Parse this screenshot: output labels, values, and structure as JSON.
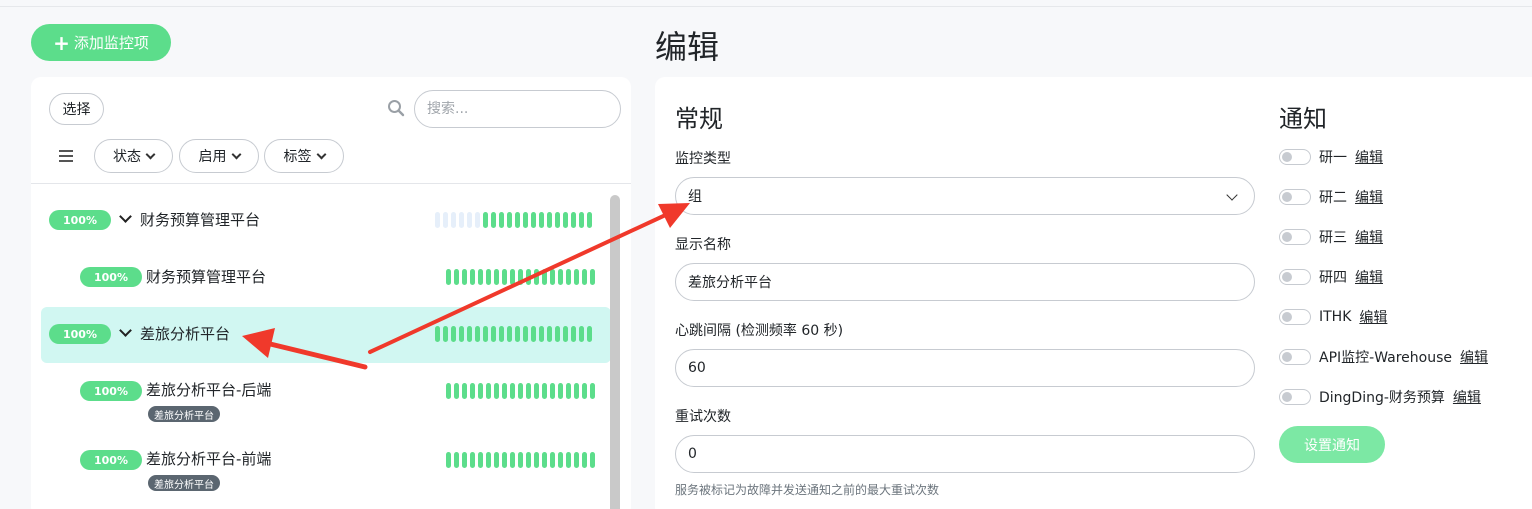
{
  "header": {
    "add_button": "添加监控项",
    "page_title": "编辑"
  },
  "left": {
    "select_label": "选择",
    "search_placeholder": "搜索...",
    "filters": [
      "状态",
      "启用",
      "标签"
    ],
    "monitors": [
      {
        "uptime": "100%",
        "name": "财务预算管理平台",
        "expandable": true,
        "indent": 0,
        "active": false,
        "tag": ""
      },
      {
        "uptime": "100%",
        "name": "财务预算管理平台",
        "expandable": false,
        "indent": 1,
        "active": false,
        "tag": ""
      },
      {
        "uptime": "100%",
        "name": "差旅分析平台",
        "expandable": true,
        "indent": 0,
        "active": true,
        "tag": ""
      },
      {
        "uptime": "100%",
        "name": "差旅分析平台-后端",
        "expandable": false,
        "indent": 1,
        "active": false,
        "tag": "差旅分析平台"
      },
      {
        "uptime": "100%",
        "name": "差旅分析平台-前端",
        "expandable": false,
        "indent": 1,
        "active": false,
        "tag": "差旅分析平台"
      }
    ]
  },
  "general": {
    "title": "常规",
    "monitor_type_label": "监控类型",
    "monitor_type_value": "组",
    "display_name_label": "显示名称",
    "display_name_value": "差旅分析平台",
    "interval_label": "心跳间隔 (检测频率 60 秒)",
    "interval_value": "60",
    "retries_label": "重试次数",
    "retries_value": "0",
    "retries_hint": "服务被标记为故障并发送通知之前的最大重试次数"
  },
  "notifications": {
    "title": "通知",
    "edit_label": "编辑",
    "items": [
      "研一",
      "研二",
      "研三",
      "研四",
      "ITHK",
      "API监控-Warehouse",
      "DingDing-财务预算"
    ],
    "setup_button": "设置通知"
  },
  "colors": {
    "accent": "#5cdd8b",
    "active_row": "#d1f7f2",
    "annotation_arrow": "#f0392b"
  }
}
